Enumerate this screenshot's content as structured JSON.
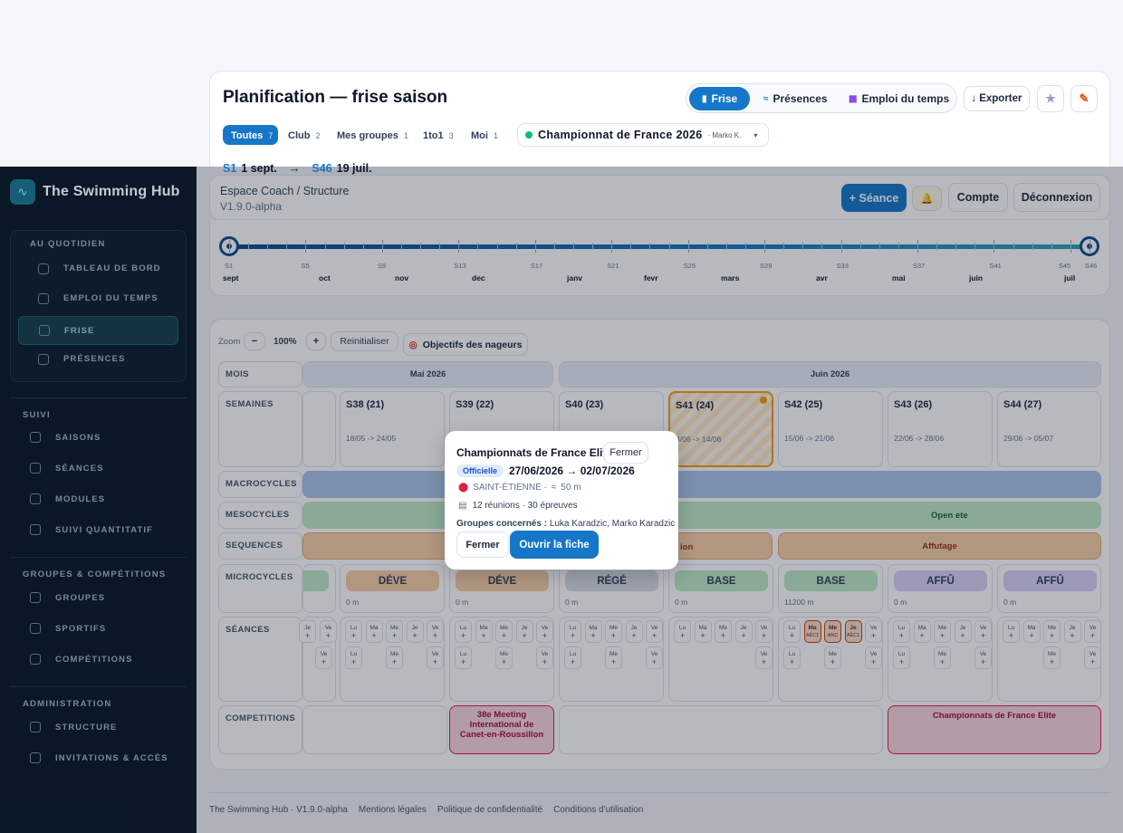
{
  "topbar": {
    "title": "Planification — frise saison",
    "views": {
      "frise": "Frise",
      "presences": "Présences",
      "emploi": "Emploi du temps"
    },
    "export_label": "Exporter",
    "filters": [
      {
        "label": "Toutes",
        "count": "7"
      },
      {
        "label": "Club",
        "count": "2"
      },
      {
        "label": "Mes groupes",
        "count": "1"
      },
      {
        "label": "1to1",
        "count": "3"
      },
      {
        "label": "Moi",
        "count": "1"
      }
    ],
    "competition_select": {
      "label": "Championnat de France 2026",
      "owner": "· Marko K."
    },
    "range": {
      "start_week": "S1",
      "start_date": "1 sept.",
      "arrow": "→",
      "end_week": "S46",
      "end_date": "19 juil."
    }
  },
  "sidebar": {
    "brand": "The Swimming Hub",
    "sections": [
      {
        "title": "AU QUOTIDIEN",
        "items": [
          "TABLEAU DE BORD",
          "EMPLOI DU TEMPS",
          "FRISE",
          "PRÉSENCES"
        ]
      },
      {
        "title": "SUIVI",
        "items": [
          "SAISONS",
          "SÉANCES",
          "MODULES",
          "SUIVI QUANTITATIF"
        ]
      },
      {
        "title": "GROUPES & COMPÉTITIONS",
        "items": [
          "GROUPES",
          "SPORTIFS",
          "COMPÉTITIONS"
        ]
      },
      {
        "title": "ADMINISTRATION",
        "items": [
          "STRUCTURE",
          "INVITATIONS & ACCÈS"
        ]
      }
    ]
  },
  "header": {
    "space_title": "Espace Coach / Structure",
    "version": "V1.9.0-alpha",
    "new_session": "+ Séance",
    "account": "Compte",
    "logout": "Déconnexion"
  },
  "timeline": {
    "weeks": [
      "S1",
      "S5",
      "S9",
      "S13",
      "S17",
      "S21",
      "S25",
      "S29",
      "S33",
      "S37",
      "S41",
      "S45",
      "S46"
    ],
    "months": [
      "sept",
      "oct",
      "nov",
      "dec",
      "janv",
      "fevr",
      "mars",
      "avr",
      "mai",
      "juin",
      "juil"
    ]
  },
  "toolbar": {
    "zoom_label": "Zoom",
    "zoom_value": "100%",
    "minus": "−",
    "plus": "+",
    "reset": "Reinitialiser",
    "objectives": "Objectifs des nageurs"
  },
  "grid": {
    "labels": {
      "mois": "MOIS",
      "semaines": "SEMAINES",
      "macro": "MACROCYCLES",
      "meso": "MESOCYCLES",
      "seq": "SEQUENCES",
      "micro": "MICROCYCLES",
      "seances": "SÉANCES",
      "comp": "COMPETITIONS"
    },
    "months": [
      "Mai 2026",
      "Juin 2026"
    ],
    "weeks": [
      {
        "title": "S38 (21)",
        "dates": "18/05 -> 24/05"
      },
      {
        "title": "S39 (22)",
        "dates": ""
      },
      {
        "title": "S40 (23)",
        "dates": ""
      },
      {
        "title": "S41 (24)",
        "dates": "8/06 -> 14/06"
      },
      {
        "title": "S42 (25)",
        "dates": "15/06 -> 21/06"
      },
      {
        "title": "S43 (26)",
        "dates": "22/06 -> 28/06"
      },
      {
        "title": "S44 (27)",
        "dates": "29/06 -> 05/07"
      }
    ],
    "meso_label": "Open ete",
    "seq_labels": [
      "ion",
      "Affutage"
    ],
    "micro": [
      {
        "label": "DÉVE",
        "vol": "0 m"
      },
      {
        "label": "DÉVE",
        "vol": "0 m"
      },
      {
        "label": "RÉGÉ",
        "vol": "0 m"
      },
      {
        "label": "BASE",
        "vol": "0 m"
      },
      {
        "label": "BASE",
        "vol": "11200 m"
      },
      {
        "label": "AFFÛ",
        "vol": "0 m"
      },
      {
        "label": "AFFÛ",
        "vol": "0 m"
      }
    ],
    "days": [
      "Lu",
      "Ma",
      "Me",
      "Je",
      "Ve"
    ],
    "special_chips": [
      {
        "d": "Ma",
        "c": "AÉC1"
      },
      {
        "d": "Me",
        "c": "ANC"
      },
      {
        "d": "Je",
        "c": "AÉC1"
      }
    ],
    "competitions": [
      "38e Meeting International de Canet-en-Roussillon",
      "Championnats de France Elite"
    ]
  },
  "popup": {
    "title": "Championnats de France Elite",
    "close_top": "Fermer",
    "badge": "Officielle",
    "dates": "27/06/2026 → 02/07/2026",
    "place": "SAINT-ÉTIENNE ·",
    "pool": "50 m",
    "stats": "12 réunions · 30 épreuves",
    "groups_label": "Groupes concernés :",
    "groups_value": "Luka Karadzic, Marko Karadzic",
    "close": "Fermer",
    "open": "Ouvrir la fiche"
  },
  "footer": {
    "version": "The Swimming Hub · V1.9.0-alpha",
    "links": [
      "Mentions légales",
      "Politique de confidentialité",
      "Conditions d'utilisation"
    ]
  },
  "colors": {
    "primary": "#1677c8",
    "sidebar": "#0b1c2d",
    "macro": "#a9c4e8",
    "meso": "#bfe8c6",
    "seq": "#f6cfa5"
  }
}
